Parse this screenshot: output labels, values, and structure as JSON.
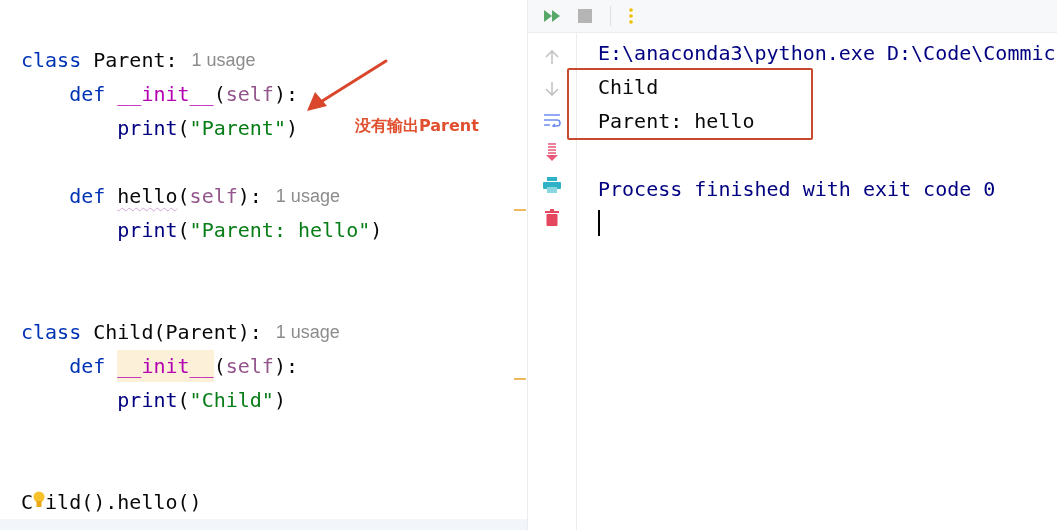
{
  "editor": {
    "lines": [
      {
        "kind": "code",
        "tokens": [
          {
            "kind": "keyword",
            "text": "class "
          },
          {
            "kind": "plain",
            "text": "Parent:"
          }
        ],
        "hint": "1 usage"
      },
      {
        "kind": "code",
        "tokens": [
          {
            "kind": "keyword",
            "text": "    def "
          },
          {
            "kind": "dunder",
            "text": "__init__"
          },
          {
            "kind": "plain",
            "text": "("
          },
          {
            "kind": "self",
            "text": "self"
          },
          {
            "kind": "plain",
            "text": "):"
          }
        ]
      },
      {
        "kind": "code",
        "tokens": [
          {
            "kind": "builtin",
            "text": "        print"
          },
          {
            "kind": "plain",
            "text": "("
          },
          {
            "kind": "string",
            "text": "\"Parent\""
          },
          {
            "kind": "plain",
            "text": ")"
          }
        ]
      },
      {
        "kind": "blank"
      },
      {
        "kind": "code",
        "tokens": [
          {
            "kind": "keyword",
            "text": "    def "
          },
          {
            "kind": "warned",
            "text": "hello"
          },
          {
            "kind": "plain",
            "text": "("
          },
          {
            "kind": "self",
            "text": "self"
          },
          {
            "kind": "plain",
            "text": "):"
          }
        ],
        "hint": "1 usage"
      },
      {
        "kind": "code",
        "tokens": [
          {
            "kind": "builtin",
            "text": "        print"
          },
          {
            "kind": "plain",
            "text": "("
          },
          {
            "kind": "string",
            "text": "\"Parent: hello\""
          },
          {
            "kind": "plain",
            "text": ")"
          }
        ]
      },
      {
        "kind": "blank"
      },
      {
        "kind": "blank"
      },
      {
        "kind": "code",
        "tokens": [
          {
            "kind": "keyword",
            "text": "class "
          },
          {
            "kind": "plain",
            "text": "Child(Parent):"
          }
        ],
        "hint": "1 usage"
      },
      {
        "kind": "code",
        "tokens": [
          {
            "kind": "keyword",
            "text": "    def "
          },
          {
            "kind": "dunder_highlighted",
            "text": "__init__"
          },
          {
            "kind": "plain",
            "text": "("
          },
          {
            "kind": "self",
            "text": "self"
          },
          {
            "kind": "plain",
            "text": "):"
          }
        ]
      },
      {
        "kind": "code",
        "tokens": [
          {
            "kind": "builtin",
            "text": "        print"
          },
          {
            "kind": "plain",
            "text": "("
          },
          {
            "kind": "string",
            "text": "\"Child\""
          },
          {
            "kind": "plain",
            "text": ")"
          }
        ]
      },
      {
        "kind": "blank"
      },
      {
        "kind": "blank"
      },
      {
        "kind": "code_with_bulb",
        "before": "C",
        "after": "ild().hello()"
      }
    ],
    "annotation": {
      "text": "没有输出Parent"
    }
  },
  "console": {
    "blocks": [
      {
        "kind": "plain",
        "lines": [
          {
            "kind": "system",
            "text": "E:\\anaconda3\\python.exe D:\\Code\\Commic"
          }
        ]
      },
      {
        "kind": "boxed",
        "lines": [
          {
            "kind": "output",
            "text": "Child"
          },
          {
            "kind": "output",
            "text": "Parent: hello"
          }
        ]
      },
      {
        "kind": "plain",
        "lines": [
          {
            "kind": "blank"
          },
          {
            "kind": "system",
            "text": "Process finished with exit code 0"
          },
          {
            "kind": "cursor"
          }
        ]
      }
    ]
  }
}
